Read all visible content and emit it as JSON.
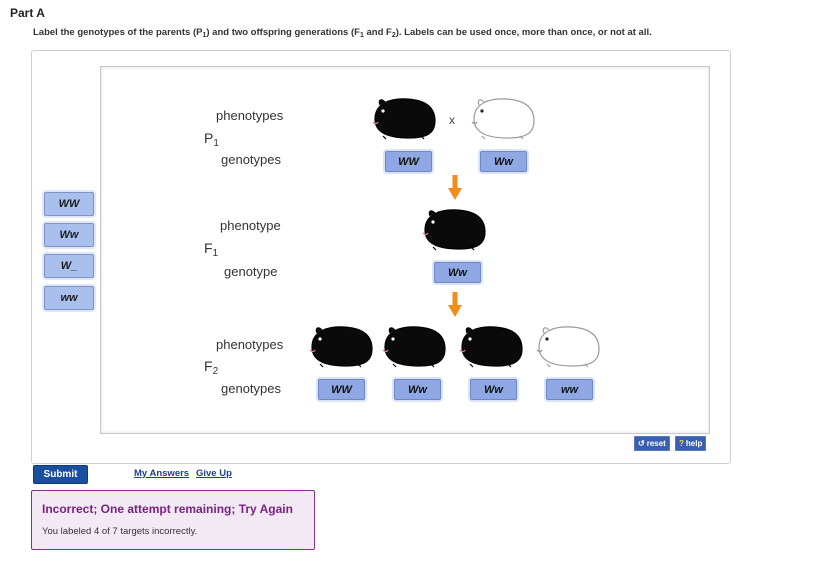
{
  "part_title": "Part A",
  "instructions": {
    "text1": "Label the genotypes of the parents (P",
    "sub1": "1",
    "text2": ") and two offspring generations (F",
    "sub2": "1",
    "text3": " and F",
    "sub3": "2",
    "text4": "). Labels can be used once, more than once, or not at all."
  },
  "label_bank": [
    "WW",
    "Ww",
    "W_",
    "ww"
  ],
  "rows": {
    "p1": {
      "phenotype_label": "phenotypes",
      "gen_letter": "P",
      "gen_sub": "1",
      "genotype_label": "genotypes"
    },
    "f1": {
      "phenotype_label": "phenotype",
      "gen_letter": "F",
      "gen_sub": "1",
      "genotype_label": "genotype"
    },
    "f2": {
      "phenotype_label": "phenotypes",
      "gen_letter": "F",
      "gen_sub": "2",
      "genotype_label": "genotypes"
    }
  },
  "cross_symbol": "x",
  "targets": {
    "p1": [
      "WW",
      "Ww"
    ],
    "f1": [
      "Ww"
    ],
    "f2": [
      "WW",
      "Ww",
      "Ww",
      "ww"
    ]
  },
  "animals": {
    "p1": [
      "black",
      "white"
    ],
    "f1": [
      "black"
    ],
    "f2": [
      "black",
      "black",
      "black",
      "white"
    ]
  },
  "tools": {
    "reset": "reset",
    "help": "help",
    "reset_icon": "reset-icon",
    "help_icon": "question-icon"
  },
  "submit_label": "Submit",
  "links": {
    "my_answers": "My Answers",
    "give_up": "Give Up"
  },
  "feedback": {
    "title": "Incorrect; One attempt remaining; Try Again",
    "message": "You labeled 4 of 7 targets incorrectly."
  },
  "colors": {
    "arrow": "#f28c1a",
    "target_fill": "#8fa8e4",
    "feedback_border": "#8a2f8f",
    "feedback_title": "#7a2281",
    "submit": "#1a4fa0"
  }
}
